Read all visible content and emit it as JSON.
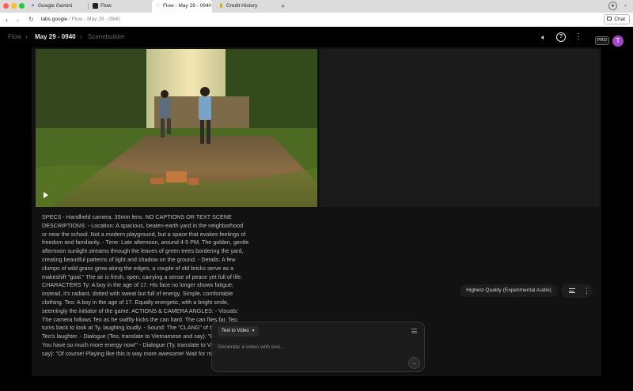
{
  "browser": {
    "tabs": [
      {
        "label": "Google Gemini",
        "active": false
      },
      {
        "label": "Flow",
        "active": false
      },
      {
        "label": "Flow - May 29 - 0940",
        "active": true
      },
      {
        "label": "Credit History",
        "active": false
      }
    ],
    "new_tab_glyph": "+",
    "url_host": "labs.google",
    "url_path": " / Flow - May 29 - 0940",
    "chat_label": "Chat"
  },
  "header": {
    "breadcrumb_root": "Flow",
    "breadcrumb_project": "May 29 - 0940",
    "breadcrumb_view": "Scenebuilder",
    "plan_badge": "PRO",
    "avatar_initial": "T"
  },
  "prompt_text": "SPECS - Handheld camera, 35mm lens. NO CAPTIONS OR TEXT SCENE DESCRIPTIONS: - Location: A spacious, beaten-earth yard in the neighborhood or near the school. Not a modern playground, but a space that evokes feelings of freedom and familiarity. - Time: Late afternoon, around 4-5 PM. The golden, gentle afternoon sunlight streams through the leaves of green trees bordering the yard, creating beautiful patterns of light and shadow on the ground. - Details: A few clumps of wild grass grow along the edges, a couple of old bricks serve as a makeshift \"goal.\" The air is fresh, open, carrying a sense of peace yet full of life. CHARACTERS Ty: A boy in the age of 17. His face no longer shows fatigue; instead, it's radiant, dotted with sweat but full of energy. Simple, comfortable clothing. Teo: A boy in the age of 17. Equally energetic, with a bright smile, seemingly the initiator of the game. ACTIONS & CAMERA ANGLES: - Visuals: The camera follows Teo as he swiftly kicks the can hard. The can flies far. Teo turns back to look at Ty, laughing loudly. - Sound: The \"CLANG\" of the kicked can, Teo's laughter. - Dialogue (Teo, translate to Vietnamese and say): \"Hurry up, Ty! You have so much more energy now!\" - Dialogue (Ty, translate to Vietnamese and say): \"Of course! Playing like this is way more awesome! Wait for me!\"",
  "quality_label": "Highest Quality (Experimental Audio)",
  "composer": {
    "mode_label": "Text to Video",
    "placeholder": "Generate a video with text...",
    "value": ""
  },
  "colors": {
    "avatar": "#a347c8",
    "background": "#000000",
    "panel": "#121212"
  }
}
